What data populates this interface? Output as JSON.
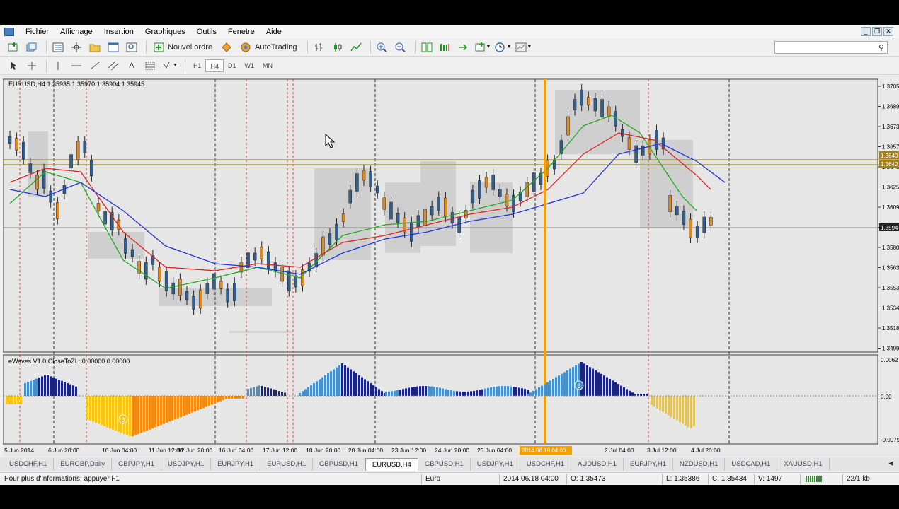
{
  "menu": [
    "Fichier",
    "Affichage",
    "Insertion",
    "Graphiques",
    "Outils",
    "Fenetre",
    "Aide"
  ],
  "toolbar": {
    "new_order": "Nouvel ordre",
    "autotrading": "AutoTrading"
  },
  "timeframes": [
    "H1",
    "H4",
    "D1",
    "W1",
    "MN"
  ],
  "active_timeframe": "H4",
  "chart": {
    "info": "EURUSD,H4  1.35935 1.35970 1.35904 1.35945",
    "indicator": "eWaves V1.0 CloseToZL: 0.00000 0.00000",
    "price_ticks": [
      "1.3705",
      "1.3689",
      "1.3673",
      "1.3657",
      "1.3641",
      "1.3625",
      "1.3609",
      "1.3593",
      "1.3580",
      "1.3563",
      "1.3553",
      "1.3534",
      "1.3518",
      "1.3499"
    ],
    "price_tags": [
      "1.3640",
      "1.3640",
      "1.3594"
    ],
    "ind_ticks": [
      "0.0062",
      "0.00",
      "-0.0079"
    ],
    "time_labels": [
      "5 Jun 2014",
      "6 Jun 20:00",
      "10 Jun 04:00",
      "11 Jun 12:00",
      "12 Jun 20:00",
      "16 Jun 04:00",
      "17 Jun 12:00",
      "18 Jun 20:00",
      "20 Jun 04:00",
      "23 Jun 12:00",
      "24 Jun 20:00",
      "26 Jun 04:00",
      "...un 20:00",
      "2 Jul 04:00",
      "3 Jul 12:00",
      "4 Jul 20:00"
    ],
    "cursor_time": "2014.06.18 04:00",
    "marker_labels": [
      "3",
      "3"
    ],
    "colors": {
      "bull": "#2e5f8f",
      "bear": "#e08a1e",
      "ma_green": "#22aa22",
      "ma_red": "#dd2222",
      "ma_blue": "#2233dd",
      "cursor": "#f5a000",
      "hist_blue_dark": "#1a237e",
      "hist_blue_light": "#4a90c8",
      "hist_yellow": "#f5c518",
      "hist_orange": "#f08a10"
    }
  },
  "tabs": [
    "USDCHF,H1",
    "EURGBP,Daily",
    "GBPJPY,H1",
    "USDJPY,H1",
    "EURJPY,H1",
    "EURUSD,H1",
    "GBPUSD,H1",
    "EURUSD,H4",
    "GBPUSD,H1",
    "USDJPY,H1",
    "USDCHF,H1",
    "AUDUSD,H1",
    "EURJPY,H1",
    "NZDUSD,H1",
    "USDCAD,H1",
    "XAUUSD,H1"
  ],
  "active_tab": "EURUSD,H4",
  "status": {
    "help": "Pour plus d'informations, appuyer F1",
    "profile": "Euro",
    "datetime": "2014.06.18 04:00",
    "open": "O: 1.35473",
    "low": "L: 1.35386",
    "close": "C: 1.35434",
    "volume": "V: 1497",
    "traffic": "22/1 kb"
  }
}
